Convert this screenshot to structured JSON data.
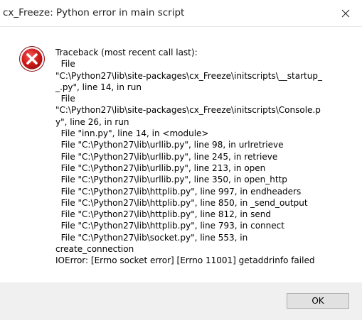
{
  "window": {
    "title": "cx_Freeze: Python error in main script",
    "close_icon": "close-icon",
    "title_color": "#ff0000"
  },
  "dialog": {
    "icon": "error-icon",
    "message_lines": [
      "Traceback (most recent call last):",
      "  File",
      "\"C:\\Python27\\lib\\site-packages\\cx_Freeze\\initscripts\\__startup_",
      "_.py\", line 14, in run",
      "  File",
      "\"C:\\Python27\\lib\\site-packages\\cx_Freeze\\initscripts\\Console.p",
      "y\", line 26, in run",
      "  File \"inn.py\", line 14, in <module>",
      "  File \"C:\\Python27\\lib\\urllib.py\", line 98, in urlretrieve",
      "  File \"C:\\Python27\\lib\\urllib.py\", line 245, in retrieve",
      "  File \"C:\\Python27\\lib\\urllib.py\", line 213, in open",
      "  File \"C:\\Python27\\lib\\urllib.py\", line 350, in open_http",
      "  File \"C:\\Python27\\lib\\httplib.py\", line 997, in endheaders",
      "  File \"C:\\Python27\\lib\\httplib.py\", line 850, in _send_output",
      "  File \"C:\\Python27\\lib\\httplib.py\", line 812, in send",
      "  File \"C:\\Python27\\lib\\httplib.py\", line 793, in connect",
      "  File \"C:\\Python27\\lib\\socket.py\", line 553, in",
      "create_connection",
      "IOError: [Errno socket error] [Errno 11001] getaddrinfo failed"
    ]
  },
  "footer": {
    "ok_label": "OK"
  },
  "colors": {
    "titlebar": "#ffffff",
    "content_bg": "#ffffff",
    "footer_bg": "#f0f0f0",
    "button_bg": "#e1e1e1",
    "error_red": "#e81123"
  }
}
